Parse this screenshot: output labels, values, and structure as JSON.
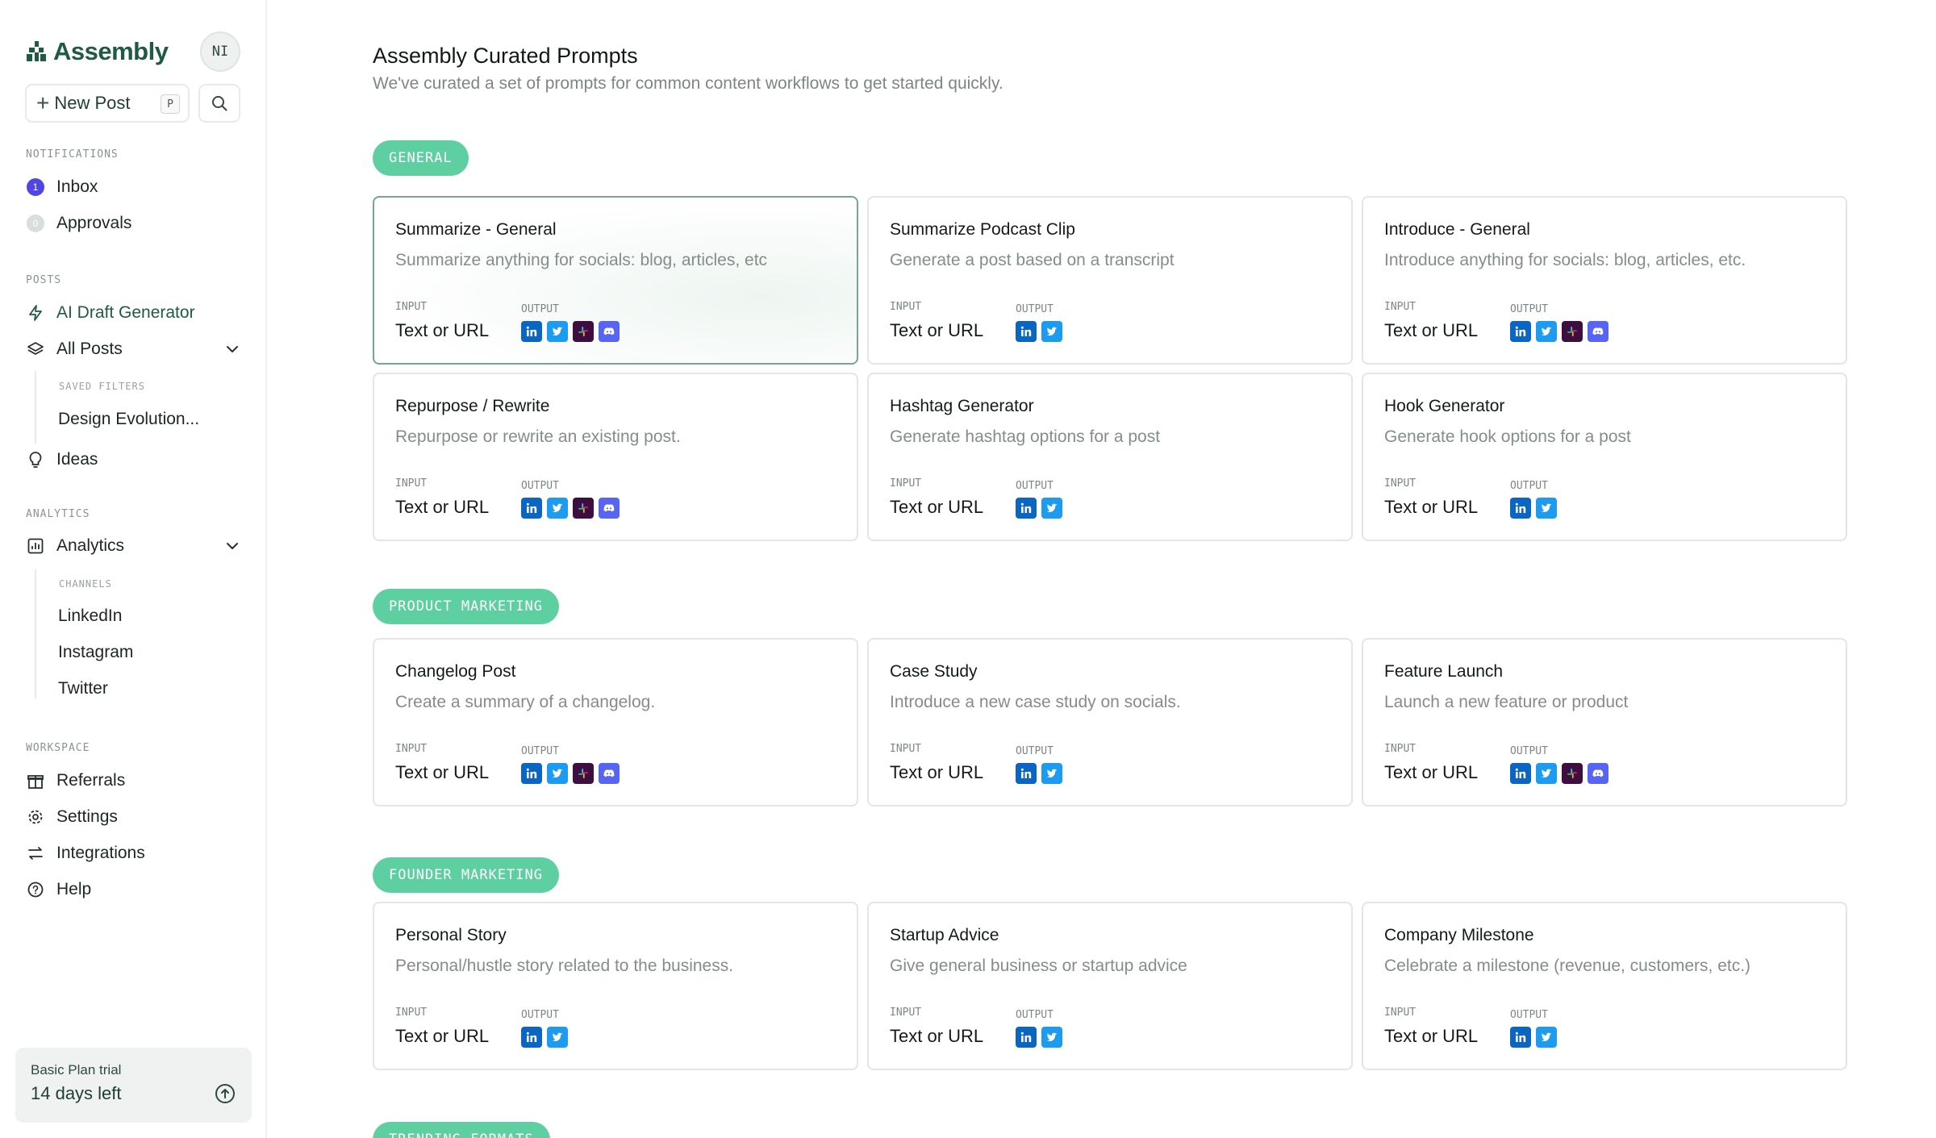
{
  "app": {
    "brand": "Assembly",
    "avatar_initials": "NI",
    "new_post_label": "New Post",
    "new_post_shortcut": "P"
  },
  "sidebar": {
    "notifications_label": "NOTIFICATIONS",
    "inbox_label": "Inbox",
    "inbox_count": "1",
    "approvals_label": "Approvals",
    "approvals_count": "0",
    "posts_label": "POSTS",
    "ai_draft_label": "AI Draft Generator",
    "all_posts_label": "All Posts",
    "saved_filters_label": "SAVED FILTERS",
    "saved_filter_1": "Design Evolution...",
    "ideas_label": "Ideas",
    "analytics_section_label": "ANALYTICS",
    "analytics_label": "Analytics",
    "channels_label": "CHANNELS",
    "channel_linkedin": "LinkedIn",
    "channel_instagram": "Instagram",
    "channel_twitter": "Twitter",
    "workspace_label": "WORKSPACE",
    "referrals_label": "Referrals",
    "settings_label": "Settings",
    "integrations_label": "Integrations",
    "help_label": "Help",
    "trial_title": "Basic Plan trial",
    "trial_days": "14 days left"
  },
  "main": {
    "title": "Assembly Curated Prompts",
    "subtitle": "We've curated a set of prompts for common content workflows to get started quickly.",
    "input_label": "INPUT",
    "output_label": "OUTPUT",
    "categories": [
      {
        "name": "GENERAL",
        "cards": [
          {
            "title": "Summarize - General",
            "desc": "Summarize anything for socials: blog, articles, etc",
            "input": "Text or URL",
            "outputs": [
              "linkedin",
              "twitter",
              "slack",
              "discord"
            ],
            "selected": true
          },
          {
            "title": "Summarize Podcast Clip",
            "desc": "Generate a post based on a transcript",
            "input": "Text or URL",
            "outputs": [
              "linkedin",
              "twitter"
            ]
          },
          {
            "title": "Introduce - General",
            "desc": "Introduce anything for socials: blog, articles, etc.",
            "input": "Text or URL",
            "outputs": [
              "linkedin",
              "twitter",
              "slack",
              "discord"
            ]
          },
          {
            "title": "Repurpose / Rewrite",
            "desc": "Repurpose or rewrite an existing post.",
            "input": "Text or URL",
            "outputs": [
              "linkedin",
              "twitter",
              "slack",
              "discord"
            ]
          },
          {
            "title": "Hashtag Generator",
            "desc": "Generate hashtag options for a post",
            "input": "Text or URL",
            "outputs": [
              "linkedin",
              "twitter"
            ]
          },
          {
            "title": "Hook Generator",
            "desc": "Generate hook options for a post",
            "input": "Text or URL",
            "outputs": [
              "linkedin",
              "twitter"
            ]
          }
        ]
      },
      {
        "name": "PRODUCT MARKETING",
        "cards": [
          {
            "title": "Changelog Post",
            "desc": "Create a summary of a changelog.",
            "input": "Text or URL",
            "outputs": [
              "linkedin",
              "twitter",
              "slack",
              "discord"
            ]
          },
          {
            "title": "Case Study",
            "desc": "Introduce a new case study on socials.",
            "input": "Text or URL",
            "outputs": [
              "linkedin",
              "twitter"
            ]
          },
          {
            "title": "Feature Launch",
            "desc": "Launch a new feature or product",
            "input": "Text or URL",
            "outputs": [
              "linkedin",
              "twitter",
              "slack",
              "discord"
            ]
          }
        ]
      },
      {
        "name": "FOUNDER MARKETING",
        "cards": [
          {
            "title": "Personal Story",
            "desc": "Personal/hustle story related to the business.",
            "input": "Text or URL",
            "outputs": [
              "linkedin",
              "twitter"
            ]
          },
          {
            "title": "Startup Advice",
            "desc": "Give general business or startup advice",
            "input": "Text or URL",
            "outputs": [
              "linkedin",
              "twitter"
            ]
          },
          {
            "title": "Company Milestone",
            "desc": "Celebrate a milestone (revenue, customers, etc.)",
            "input": "Text or URL",
            "outputs": [
              "linkedin",
              "twitter"
            ]
          }
        ]
      },
      {
        "name": "TRENDING FORMATS",
        "cards": []
      }
    ]
  },
  "colors": {
    "accent": "#5ecfa0",
    "brand": "#1f5a43",
    "linkedin": "#0a66c2",
    "twitter": "#1d9bf0",
    "slack": "#3f0e40",
    "discord": "#5865f2",
    "inbox_badge": "#4f46e5"
  }
}
